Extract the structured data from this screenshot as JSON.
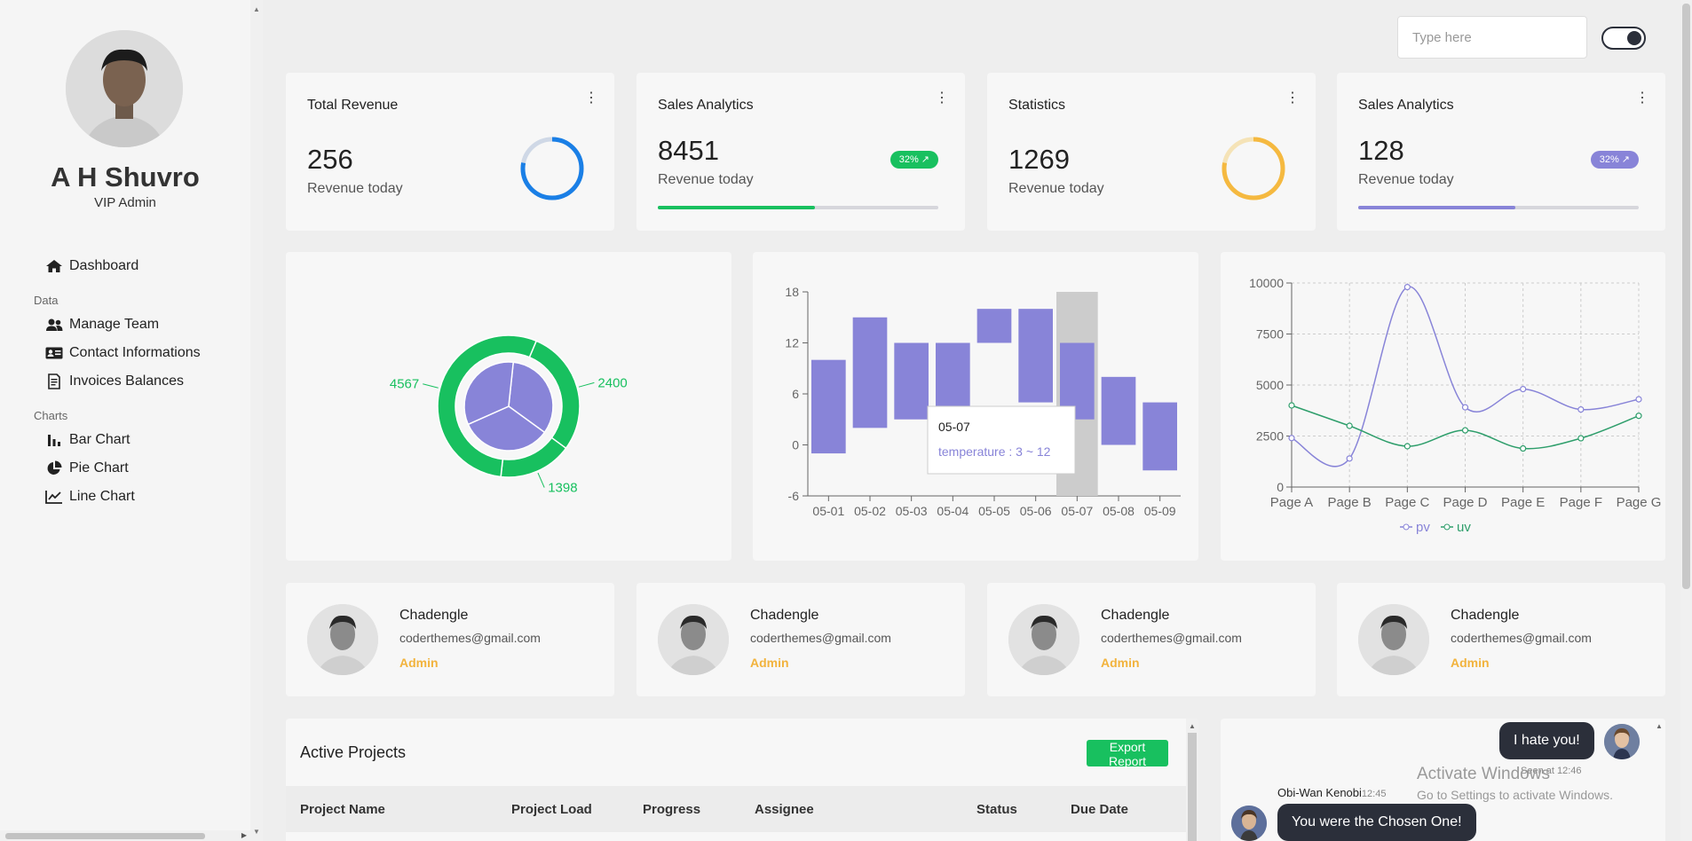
{
  "sidebar": {
    "profile": {
      "name": "A H Shuvro",
      "role": "VIP Admin"
    },
    "dashboard": "Dashboard",
    "sections": [
      {
        "label": "Data",
        "items": [
          "Manage Team",
          "Contact Informations",
          "Invoices Balances"
        ]
      },
      {
        "label": "Charts",
        "items": [
          "Bar Chart",
          "Pie Chart",
          "Line Chart"
        ]
      }
    ]
  },
  "topbar": {
    "search_placeholder": "Type here"
  },
  "stats": [
    {
      "title": "Total Revenue",
      "value": "256",
      "sub": "Revenue today",
      "ring_color": "#1a7fe6",
      "ring_progress": 0.78
    },
    {
      "title": "Sales Analytics",
      "value": "8451",
      "sub": "Revenue today",
      "badge": "32% ↗",
      "badge_color": "#18c05f",
      "progress": 0.56
    },
    {
      "title": "Statistics",
      "value": "1269",
      "sub": "Revenue today",
      "ring_color": "#f5b940",
      "ring_progress": 0.78
    },
    {
      "title": "Sales Analytics",
      "value": "128",
      "sub": "Revenue today",
      "badge": "32% ↗",
      "badge_color": "#8884d8",
      "progress": 0.56
    }
  ],
  "chart_data": [
    {
      "type": "pie",
      "inner": {
        "values": [
          1,
          1,
          1
        ],
        "color": "#8884d8"
      },
      "outer": {
        "color": "#18c05f",
        "labels": [
          "2400",
          "1398",
          "4567"
        ],
        "values": [
          2400,
          1398,
          4567
        ]
      }
    },
    {
      "type": "bar",
      "categories": [
        "05-01",
        "05-02",
        "05-03",
        "05-04",
        "05-05",
        "05-06",
        "05-07",
        "05-08",
        "05-09"
      ],
      "ranges": [
        [
          -1,
          10
        ],
        [
          2,
          15
        ],
        [
          3,
          12
        ],
        [
          4,
          12
        ],
        [
          12,
          16
        ],
        [
          5,
          16
        ],
        [
          3,
          12
        ],
        [
          0,
          8
        ],
        [
          -3,
          5
        ]
      ],
      "yticks": [
        18,
        12,
        6,
        0,
        -6
      ],
      "ylim": [
        -6,
        18
      ],
      "color": "#8884d8",
      "tooltip": {
        "title": "05-07",
        "label": "temperature : 3 ~ 12"
      }
    },
    {
      "type": "line",
      "categories": [
        "Page A",
        "Page B",
        "Page C",
        "Page D",
        "Page E",
        "Page F",
        "Page G"
      ],
      "yticks": [
        10000,
        7500,
        5000,
        2500,
        0
      ],
      "ylim": [
        0,
        10000
      ],
      "series": [
        {
          "name": "pv",
          "color": "#8884d8",
          "values": [
            2400,
            1398,
            9800,
            3908,
            4800,
            3800,
            4300
          ]
        },
        {
          "name": "uv",
          "color": "#2e9e6b",
          "values": [
            4000,
            3000,
            2000,
            2780,
            1890,
            2390,
            3490
          ]
        }
      ]
    }
  ],
  "team": [
    {
      "name": "Chadengle",
      "email": "coderthemes@gmail.com",
      "role": "Admin"
    },
    {
      "name": "Chadengle",
      "email": "coderthemes@gmail.com",
      "role": "Admin"
    },
    {
      "name": "Chadengle",
      "email": "coderthemes@gmail.com",
      "role": "Admin"
    },
    {
      "name": "Chadengle",
      "email": "coderthemes@gmail.com",
      "role": "Admin"
    }
  ],
  "projects": {
    "title": "Active Projects",
    "export_label": "Export Report",
    "columns": [
      "Project Name",
      "Project Load",
      "Progress",
      "Assignee",
      "Status",
      "Due Date"
    ]
  },
  "chat": {
    "msg1": "I hate you!",
    "seen": "Seen at 12:46",
    "sender": "Obi-Wan Kenobi",
    "time": "12:45",
    "msg2": "You were the Chosen One!"
  },
  "watermark": {
    "line1": "Activate Windows",
    "line2": "Go to Settings to activate Windows."
  }
}
